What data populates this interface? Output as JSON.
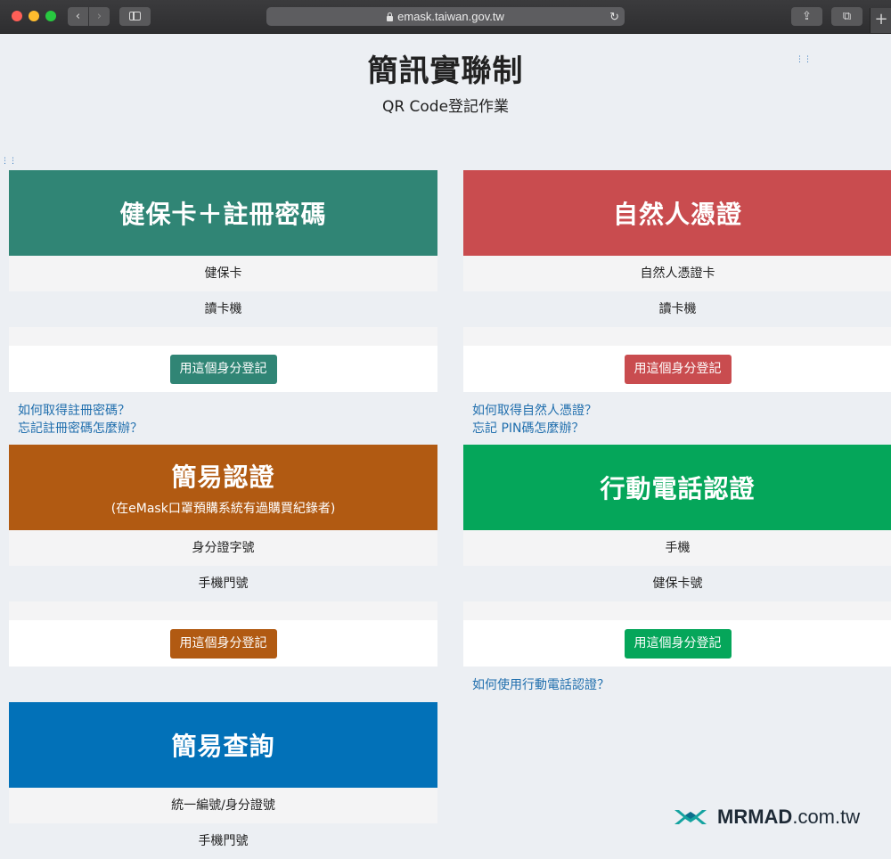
{
  "browser": {
    "url": "emask.taiwan.gov.tw",
    "back_glyph": "‹",
    "forward_glyph": "›",
    "reload_glyph": "↻",
    "share_glyph": "⇪",
    "tabs_glyph": "⧉",
    "newtab_glyph": "+"
  },
  "page": {
    "title": "簡訊實聯制",
    "subtitle": "QR Code登記作業",
    "grip": "⋮⋮"
  },
  "cards": [
    {
      "title": "健保卡＋註冊密碼",
      "color": "#308575",
      "rows": [
        "健保卡",
        "讀卡機"
      ],
      "button": "用這個身分登記",
      "links": [
        "如何取得註冊密碼？",
        "忘記註冊密碼怎麼辦？"
      ]
    },
    {
      "title": "自然人憑證",
      "color": "#c94c4f",
      "rows": [
        "自然人憑證卡",
        "讀卡機"
      ],
      "button": "用這個身分登記",
      "links": [
        "如何取得自然人憑證？",
        "忘記 PIN碼怎麼辦？"
      ]
    },
    {
      "title": "簡易認證",
      "subtitle": "(在eMask口罩預購系統有過購買紀錄者)",
      "color": "#b15a12",
      "rows": [
        "身分證字號",
        "手機門號"
      ],
      "button": "用這個身分登記",
      "links": []
    },
    {
      "title": "行動電話認證",
      "color": "#05a65a",
      "rows": [
        "手機",
        "健保卡號"
      ],
      "button": "用這個身分登記",
      "links": [
        "如何使用行動電話認證？"
      ]
    },
    {
      "title": "簡易查詢",
      "color": "#0271b8",
      "rows": [
        "統一編號/身分證號",
        "手機門號"
      ]
    }
  ],
  "watermark": {
    "brand": "MRMAD",
    "suffix": ".com.tw"
  }
}
